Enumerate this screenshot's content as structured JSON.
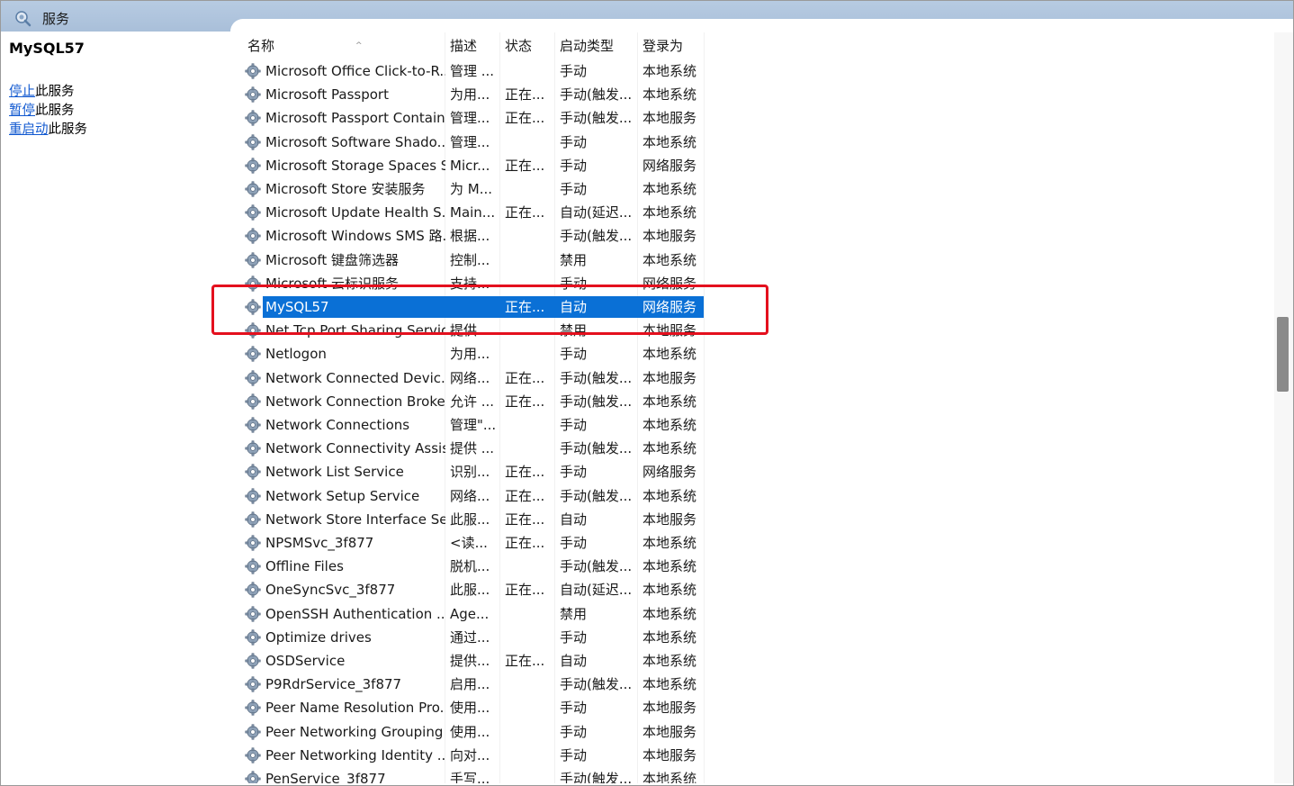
{
  "window": {
    "title": "服务"
  },
  "left_pane": {
    "service_name": "MySQL57",
    "actions": [
      {
        "link": "停止",
        "suffix": "此服务"
      },
      {
        "link": "暂停",
        "suffix": "此服务"
      },
      {
        "link": "重启动",
        "suffix": "此服务"
      }
    ]
  },
  "columns": {
    "name": "名称",
    "desc": "描述",
    "state": "状态",
    "start": "启动类型",
    "logon": "登录为",
    "sort_glyph": "^"
  },
  "rows": [
    {
      "name": "Microsoft Office Click-to-R...",
      "desc": "管理 ...",
      "state": "",
      "start": "手动",
      "logon": "本地系统"
    },
    {
      "name": "Microsoft Passport",
      "desc": "为用...",
      "state": "正在...",
      "start": "手动(触发...",
      "logon": "本地系统"
    },
    {
      "name": "Microsoft Passport Container",
      "desc": "管理...",
      "state": "正在...",
      "start": "手动(触发...",
      "logon": "本地服务"
    },
    {
      "name": "Microsoft Software Shado...",
      "desc": "管理...",
      "state": "",
      "start": "手动",
      "logon": "本地系统"
    },
    {
      "name": "Microsoft Storage Spaces S...",
      "desc": "Micr...",
      "state": "正在...",
      "start": "手动",
      "logon": "网络服务"
    },
    {
      "name": "Microsoft Store 安装服务",
      "desc": "为 M...",
      "state": "",
      "start": "手动",
      "logon": "本地系统"
    },
    {
      "name": "Microsoft Update Health S...",
      "desc": "Main...",
      "state": "正在...",
      "start": "自动(延迟...",
      "logon": "本地系统"
    },
    {
      "name": "Microsoft Windows SMS 路...",
      "desc": "根据...",
      "state": "",
      "start": "手动(触发...",
      "logon": "本地服务"
    },
    {
      "name": "Microsoft 键盘筛选器",
      "desc": "控制...",
      "state": "",
      "start": "禁用",
      "logon": "本地系统"
    },
    {
      "name": "Microsoft 云标识服务",
      "desc": "支持...",
      "state": "",
      "start": "手动",
      "logon": "网络服务"
    },
    {
      "name": "MySQL57",
      "desc": "",
      "state": "正在...",
      "start": "自动",
      "logon": "网络服务",
      "selected": true
    },
    {
      "name": "Net.Tcp Port Sharing Service",
      "desc": "提供...",
      "state": "",
      "start": "禁用",
      "logon": "本地服务"
    },
    {
      "name": "Netlogon",
      "desc": "为用...",
      "state": "",
      "start": "手动",
      "logon": "本地系统"
    },
    {
      "name": "Network Connected Devic...",
      "desc": "网络...",
      "state": "正在...",
      "start": "手动(触发...",
      "logon": "本地服务"
    },
    {
      "name": "Network Connection Broker",
      "desc": "允许 ...",
      "state": "正在...",
      "start": "手动(触发...",
      "logon": "本地系统"
    },
    {
      "name": "Network Connections",
      "desc": "管理\"...",
      "state": "",
      "start": "手动",
      "logon": "本地系统"
    },
    {
      "name": "Network Connectivity Assis...",
      "desc": "提供 ...",
      "state": "",
      "start": "手动(触发...",
      "logon": "本地系统"
    },
    {
      "name": "Network List Service",
      "desc": "识别...",
      "state": "正在...",
      "start": "手动",
      "logon": "网络服务"
    },
    {
      "name": "Network Setup Service",
      "desc": "网络...",
      "state": "正在...",
      "start": "手动(触发...",
      "logon": "本地系统"
    },
    {
      "name": "Network Store Interface Se...",
      "desc": "此服...",
      "state": "正在...",
      "start": "自动",
      "logon": "本地服务"
    },
    {
      "name": "NPSMSvc_3f877",
      "desc": "<读...",
      "state": "正在...",
      "start": "手动",
      "logon": "本地系统"
    },
    {
      "name": "Offline Files",
      "desc": "脱机...",
      "state": "",
      "start": "手动(触发...",
      "logon": "本地系统"
    },
    {
      "name": "OneSyncSvc_3f877",
      "desc": "此服...",
      "state": "正在...",
      "start": "自动(延迟...",
      "logon": "本地系统"
    },
    {
      "name": "OpenSSH Authentication ...",
      "desc": "Age...",
      "state": "",
      "start": "禁用",
      "logon": "本地系统"
    },
    {
      "name": "Optimize drives",
      "desc": "通过...",
      "state": "",
      "start": "手动",
      "logon": "本地系统"
    },
    {
      "name": "OSDService",
      "desc": "提供...",
      "state": "正在...",
      "start": "自动",
      "logon": "本地系统"
    },
    {
      "name": "P9RdrService_3f877",
      "desc": "启用...",
      "state": "",
      "start": "手动(触发...",
      "logon": "本地系统"
    },
    {
      "name": "Peer Name Resolution Pro...",
      "desc": "使用...",
      "state": "",
      "start": "手动",
      "logon": "本地服务"
    },
    {
      "name": "Peer Networking Grouping",
      "desc": "使用...",
      "state": "",
      "start": "手动",
      "logon": "本地服务"
    },
    {
      "name": "Peer Networking Identity ...",
      "desc": "向对...",
      "state": "",
      "start": "手动",
      "logon": "本地服务"
    },
    {
      "name": "PenService_3f877",
      "desc": "手写...",
      "state": "",
      "start": "手动(触发...",
      "logon": "本地系统"
    }
  ],
  "colors": {
    "selection": "#0a70d6",
    "link": "#1058d0",
    "highlight_box": "#e4101e",
    "titlebar": "#b7cbe2"
  },
  "icons": {
    "title": "magnifier-gear-icon",
    "row": "service-gear-icon"
  }
}
